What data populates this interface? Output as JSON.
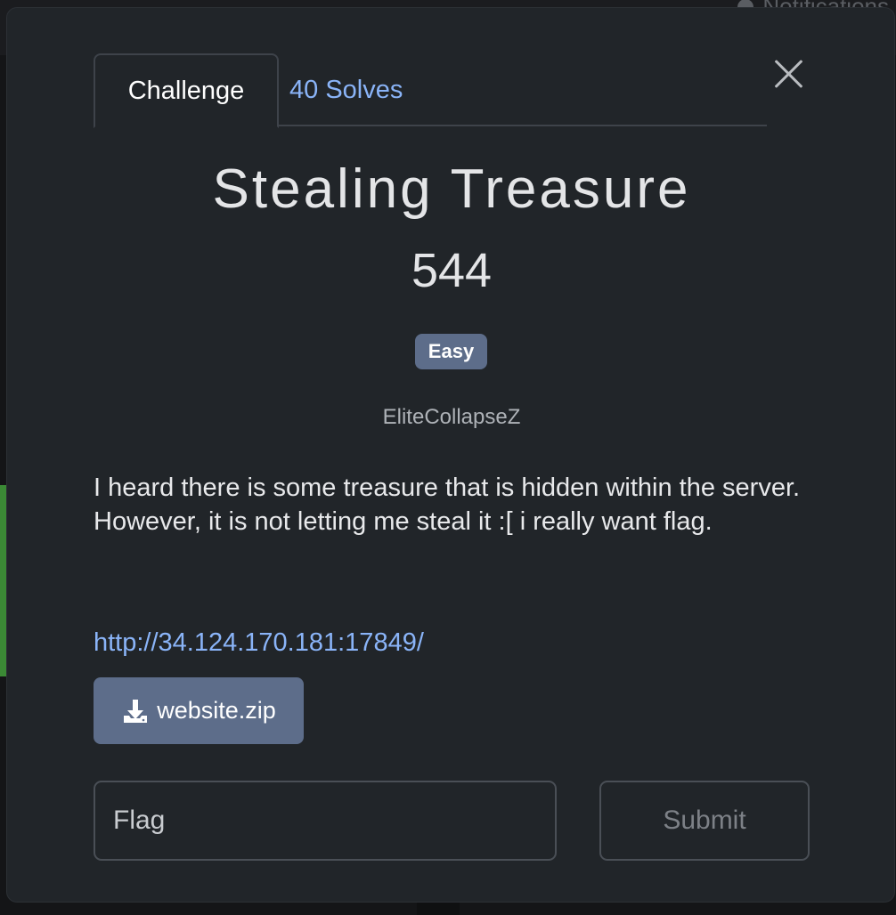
{
  "background": {
    "notifications_label": "Notifications"
  },
  "tabs": [
    {
      "label": "Challenge",
      "active": true
    },
    {
      "label": "40 Solves",
      "active": false
    }
  ],
  "challenge": {
    "title": "Stealing Treasure",
    "points": "544",
    "difficulty": "Easy",
    "author": "EliteCollapseZ",
    "description": "I heard there is some treasure that is hidden within the server. However, it is not letting me steal it :[ i really want flag.",
    "link": "http://34.124.170.181:17849/",
    "file_label": "website.zip"
  },
  "form": {
    "flag_placeholder": "Flag",
    "flag_value": "",
    "submit_label": "Submit"
  },
  "colors": {
    "accent": "#8ab4f8",
    "badge": "#5d6d8a",
    "modal_bg": "#212529"
  }
}
